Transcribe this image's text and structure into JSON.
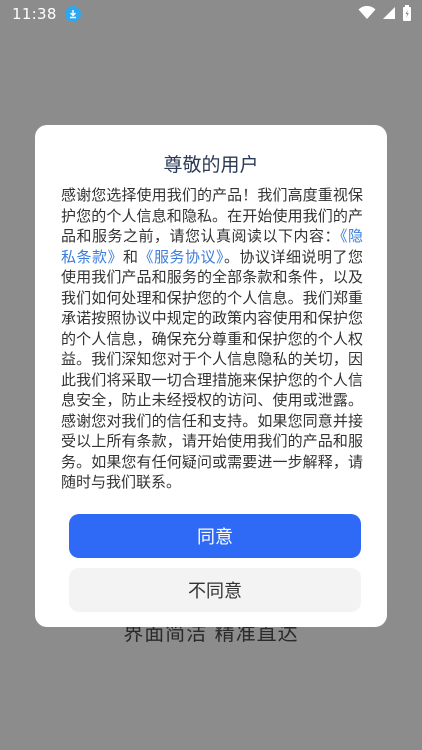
{
  "status_bar": {
    "time": "11:38",
    "icons": [
      "download-icon",
      "wifi-icon",
      "signal-icon",
      "battery-icon"
    ]
  },
  "background": {
    "slogan": "界面简洁 精准直达"
  },
  "dialog": {
    "title": "尊敬的用户",
    "body_intro": "感谢您选择使用我们的产品！我们高度重视保护您的个人信息和隐私。在开始使用我们的产品和服务之前，请您认真阅读以下内容：",
    "privacy_link": "《隐私条款》",
    "connector": "和",
    "service_link": "《服务协议》",
    "body_rest": "。协议详细说明了您使用我们产品和服务的全部条款和条件，以及我们如何处理和保护您的个人信息。我们郑重承诺按照协议中规定的政策内容使用和保护您的个人信息，确保充分尊重和保护您的个人权益。我们深知您对于个人信息隐私的关切，因此我们将采取一切合理措施来保护您的个人信息安全，防止未经授权的访问、使用或泄露。感谢您对我们的信任和支持。如果您同意并接受以上所有条款，请开始使用我们的产品和服务。如果您有任何疑问或需要进一步解释，请随时与我们联系。",
    "agree_label": "同意",
    "disagree_label": "不同意"
  },
  "colors": {
    "overlay": "#8c8c8c",
    "primary_button": "#2f6af6",
    "link": "#3b7ddd",
    "title": "#2b3b55"
  }
}
